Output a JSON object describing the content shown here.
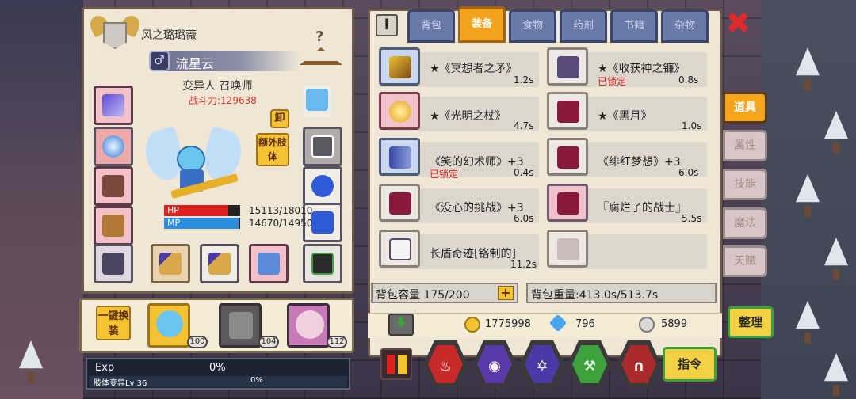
{
  "character": {
    "guild_name": "风之璐璐薇",
    "title": "流星云",
    "gender_symbol": "♂",
    "class": "变异人 召唤师",
    "power": "战斗力:129638",
    "hp_label": "HP",
    "hp_value": "15113/18010",
    "hp_fraction": 0.84,
    "mp_label": "MP",
    "mp_value": "14670/14950",
    "mp_fraction": 0.98,
    "unequip_label": "卸",
    "extra_body_label": "额外肢体",
    "hanger_mark": "?"
  },
  "party": {
    "swap_label": "一键换装",
    "members": [
      {
        "level": "100"
      },
      {
        "level": "104"
      },
      {
        "level": "112"
      }
    ]
  },
  "exp": {
    "label": "Exp",
    "percent": "0%",
    "sub_label": "肢体变异Lv 36",
    "sub_percent": "0%"
  },
  "inventory": {
    "info_label": "i",
    "tabs": [
      "背包",
      "装备",
      "食物",
      "药剂",
      "书籍",
      "杂物"
    ],
    "active_tab": "装备",
    "side_tabs": [
      "道具",
      "属性",
      "技能",
      "魔法",
      "天赋"
    ],
    "items": [
      {
        "name": "★《冥想者之矛》",
        "time": "1.2s",
        "lock": ""
      },
      {
        "name": "★《收获神之镰》",
        "time": "0.8s",
        "lock": "已锁定"
      },
      {
        "name": "★《光明之杖》",
        "time": "4.7s",
        "lock": ""
      },
      {
        "name": "★《黑月》",
        "time": "1.0s",
        "lock": ""
      },
      {
        "name": "《笑的幻术师》+3",
        "time": "0.4s",
        "lock": "已锁定"
      },
      {
        "name": "《绯红梦想》+3",
        "time": "6.0s",
        "lock": ""
      },
      {
        "name": "《没心的挑战》+3",
        "time": "6.0s",
        "lock": ""
      },
      {
        "name": "『腐烂了的战士』",
        "time": "5.5s",
        "lock": ""
      },
      {
        "name": "长盾奇迹[铬制的]",
        "time": "11.2s",
        "lock": ""
      },
      {
        "name": "",
        "time": "",
        "lock": ""
      }
    ],
    "capacity": "背包容量 175/200",
    "capacity_plus": "+",
    "weight": "背包重量:413.0s/513.7s",
    "gold": "1775998",
    "gems": "796",
    "silver": "5899",
    "sort_label": "整理",
    "command_label": "指令",
    "close_label": "✖"
  },
  "colors": {
    "accent": "#f2a21c",
    "hp": "#e02020",
    "mp": "#2a8ee0",
    "lock": "#d2221c"
  }
}
